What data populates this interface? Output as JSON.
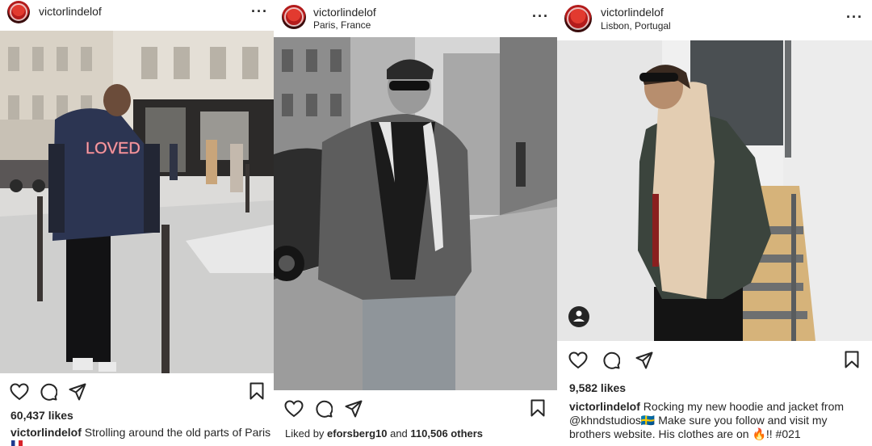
{
  "posts": [
    {
      "username": "victorlindelof",
      "location": "",
      "jacket_text": "LOVED",
      "likes": "60,437 likes",
      "caption_user": "victorlindelof",
      "caption_text": "Strolling around the old parts of Paris"
    },
    {
      "username": "victorlindelof",
      "location": "Paris, France",
      "liked_prefix": "Liked by",
      "liked_user": "eforsberg10",
      "liked_and": "and",
      "liked_others": "110,506 others"
    },
    {
      "username": "victorlindelof",
      "location": "Lisbon, Portugal",
      "likes": "9,582 likes",
      "caption_user": "victorlindelof",
      "caption_text": "Rocking my new hoodie and jacket from @khndstudios🇸🇪 Make sure you follow and visit my brothers website. His clothes are on 🔥!! #021"
    }
  ],
  "icons": [
    "heart-icon",
    "comment-icon",
    "share-icon",
    "bookmark-icon",
    "more-icon",
    "tagged-user-icon"
  ]
}
